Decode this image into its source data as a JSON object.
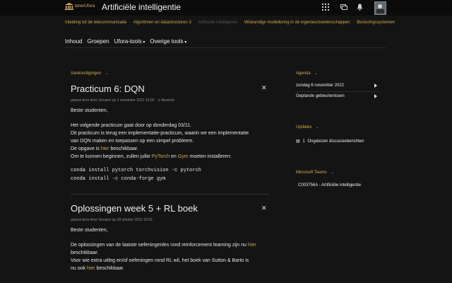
{
  "header": {
    "logo_text": "tenerUfora",
    "title": "Artificiële intelligentie"
  },
  "course_nav": [
    "Inleiding tot de telecommunicatie",
    "Algoritmen en datastructuren 3",
    "Artificiële intelligentie",
    "Wiskundige modellering in de ingenieurswetenschappen",
    "Besturingssystemen"
  ],
  "main_nav": [
    "Inhoud",
    "Groepen",
    "Ufora-tools",
    "Overige tools"
  ],
  "announcements": {
    "title": "Aankondigingen",
    "posts": [
      {
        "title": "Practicum 6: DQN",
        "meta": "gepost door Arne Gevaert op 1 november 2022 10:00",
        "edited": "Bewerkt",
        "greeting": "Beste studenten,",
        "line1": "Het volgende practicum gaat door op donderdag 03/11.",
        "line2": "Dit practicum is terug een implementatie-practicum, waarin we een implementatie",
        "line3": "van DQN maken en toepassen op een simpel probleem.",
        "line4a": "De opgave is ",
        "link_hier": "hier",
        "line4b": " beschikbaar.",
        "line5a": "Om te kunnen beginnen, zullen jullie ",
        "link_pytorch": "PyTorch",
        "line5b": " en ",
        "link_gym": "Gym",
        "line5c": " moeten installeren:",
        "code1": "conda install pytorch torchvision -c pytorch",
        "code2": "conda install -c conda-forge gym"
      },
      {
        "title": "Oplossingen week 5 + RL boek",
        "meta": "gepost door Arne Gevaert op 28 oktober 2022 15:56",
        "greeting": "Beste studenten,",
        "line1a": "De oplossingen van de laatste oefeningenles rond reinforcement learning zijn nu ",
        "link1": "hier",
        "line1b": "beschikbaar.",
        "line2": "Voor wie extra uitleg en/of oefeningen rond RL wil, het boek van Sutton & Barto is",
        "line3a": "nu ook ",
        "link2": "hier",
        "line3b": " beschikbaar."
      }
    ]
  },
  "agenda": {
    "title": "Agenda",
    "date": "zondag 6 november 2022",
    "planned": "Geplande gebeurtenissen"
  },
  "updates": {
    "title": "Updates",
    "count": "1",
    "text": "Ongelezen discussieberichten"
  },
  "teams": {
    "title": "Microsoft Teams",
    "item": "C003756A - Artificiële intelligentie"
  },
  "colors": {
    "accent": "#d4a850",
    "background": "#141414",
    "topbar": "#0b0b0b"
  }
}
